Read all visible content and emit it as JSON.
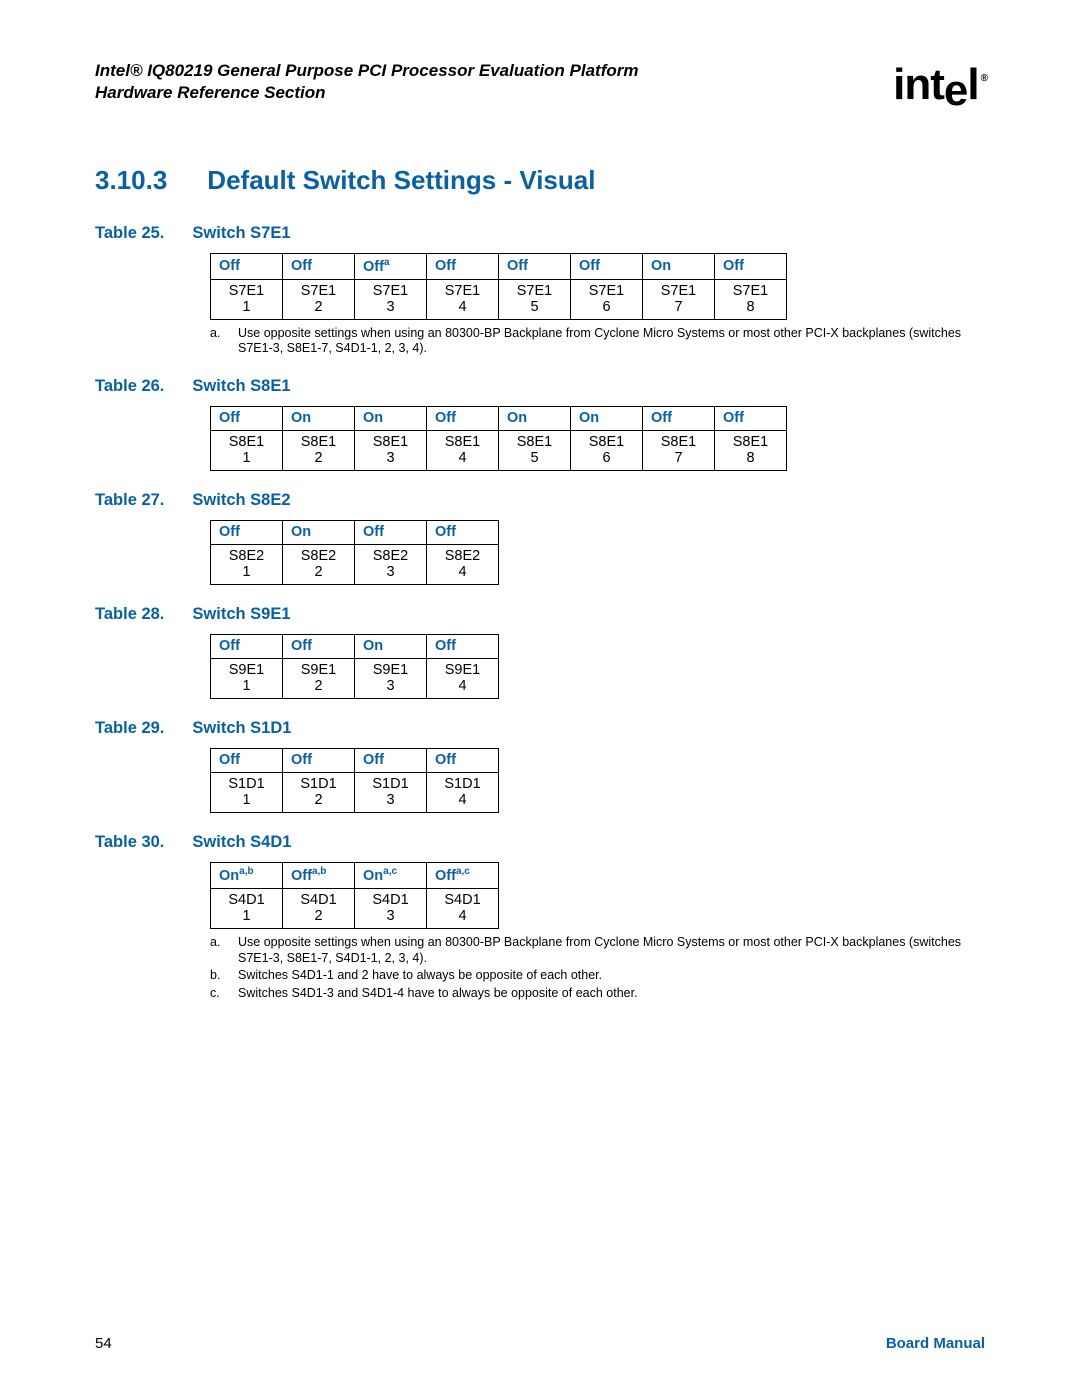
{
  "header": {
    "title_line1": "Intel® IQ80219 General Purpose PCI Processor Evaluation Platform",
    "title_line2": "Hardware Reference Section",
    "logo_text": "intel",
    "logo_r": "®"
  },
  "section": {
    "number": "3.10.3",
    "title": "Default Switch Settings - Visual"
  },
  "tables": [
    {
      "cap_prefix": "Table 25.",
      "cap_name": "Switch S7E1",
      "headers": [
        {
          "t": "Off"
        },
        {
          "t": "Off"
        },
        {
          "t": "Off",
          "sup": "a"
        },
        {
          "t": "Off"
        },
        {
          "t": "Off"
        },
        {
          "t": "Off"
        },
        {
          "t": "On"
        },
        {
          "t": "Off"
        }
      ],
      "row_label": "S7E1",
      "cols": 8,
      "footnotes": [
        {
          "lbl": "a.",
          "txt": "Use opposite settings when using an 80300-BP Backplane from Cyclone Micro Systems or most other PCI-X backplanes (switches S7E1-3, S8E1-7, S4D1-1, 2, 3, 4)."
        }
      ]
    },
    {
      "cap_prefix": "Table 26.",
      "cap_name": "Switch S8E1",
      "headers": [
        {
          "t": "Off"
        },
        {
          "t": "On"
        },
        {
          "t": "On"
        },
        {
          "t": "Off"
        },
        {
          "t": "On"
        },
        {
          "t": "On"
        },
        {
          "t": "Off"
        },
        {
          "t": "Off"
        }
      ],
      "row_label": "S8E1",
      "cols": 8,
      "footnotes": []
    },
    {
      "cap_prefix": "Table 27.",
      "cap_name": "Switch S8E2",
      "headers": [
        {
          "t": "Off"
        },
        {
          "t": "On"
        },
        {
          "t": "Off"
        },
        {
          "t": "Off"
        }
      ],
      "row_label": "S8E2",
      "cols": 4,
      "footnotes": []
    },
    {
      "cap_prefix": "Table 28.",
      "cap_name": "Switch S9E1",
      "headers": [
        {
          "t": "Off"
        },
        {
          "t": "Off"
        },
        {
          "t": "On"
        },
        {
          "t": "Off"
        }
      ],
      "row_label": "S9E1",
      "cols": 4,
      "footnotes": []
    },
    {
      "cap_prefix": "Table 29.",
      "cap_name": "Switch S1D1",
      "headers": [
        {
          "t": "Off"
        },
        {
          "t": "Off"
        },
        {
          "t": "Off"
        },
        {
          "t": "Off"
        }
      ],
      "row_label": "S1D1",
      "cols": 4,
      "footnotes": []
    },
    {
      "cap_prefix": "Table 30.",
      "cap_name": "Switch S4D1",
      "headers": [
        {
          "t": "On",
          "sup": "a,b"
        },
        {
          "t": "Off",
          "sup": "a,b"
        },
        {
          "t": "On",
          "sup": "a,c"
        },
        {
          "t": "Off",
          "sup": "a,c"
        }
      ],
      "row_label": "S4D1",
      "cols": 4,
      "footnotes": [
        {
          "lbl": "a.",
          "txt": "Use opposite settings when using an 80300-BP Backplane from Cyclone Micro Systems or most other PCI-X backplanes (switches S7E1-3, S8E1-7, S4D1-1, 2, 3, 4)."
        },
        {
          "lbl": "b.",
          "txt": "Switches S4D1-1 and 2 have to always be opposite of each other."
        },
        {
          "lbl": "c.",
          "txt": "Switches S4D1-3 and S4D1-4 have to always be opposite of each other."
        }
      ]
    }
  ],
  "footer": {
    "page": "54",
    "right": "Board Manual"
  }
}
